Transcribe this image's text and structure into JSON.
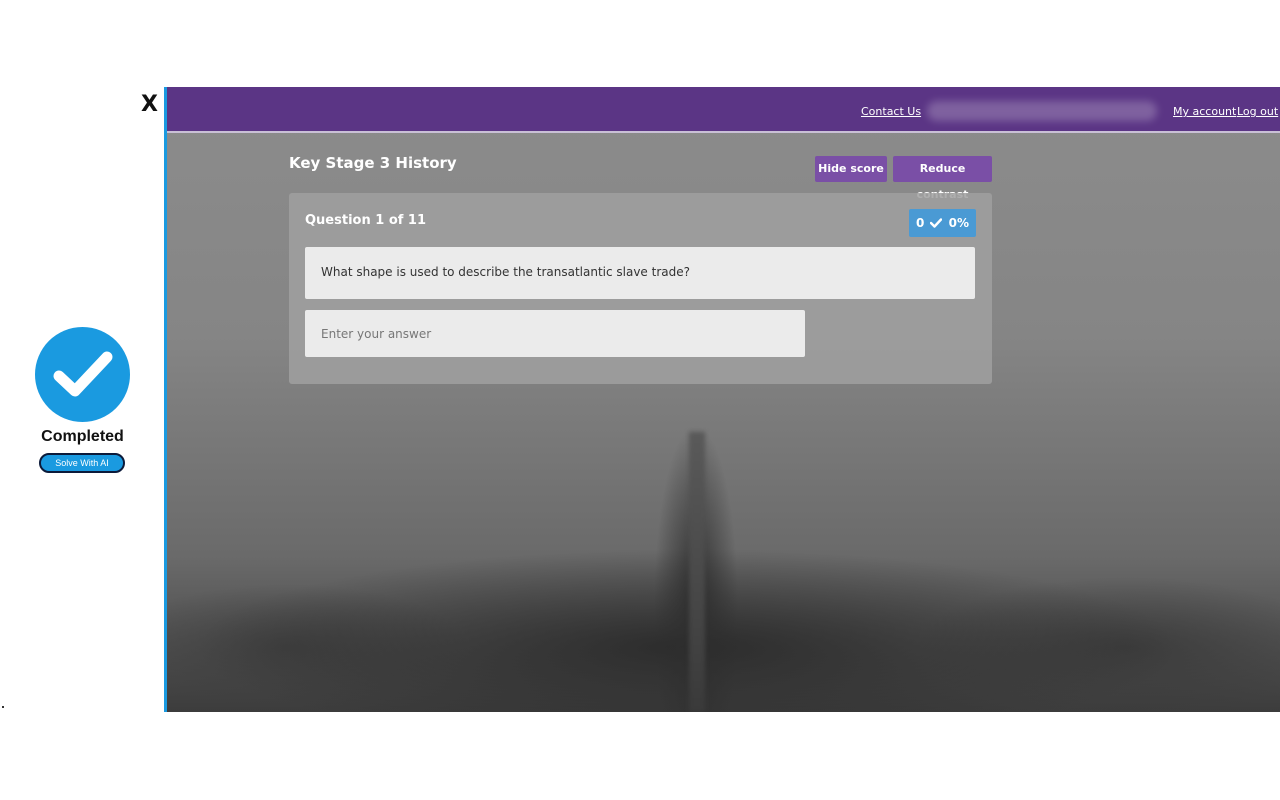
{
  "overlay": {
    "close_label": "X",
    "status_label": "Completed",
    "solve_button_label": "Solve With AI",
    "accent_color": "#1a9ae0"
  },
  "topbar": {
    "contact_label": "Contact Us",
    "my_account_label": "My account",
    "logout_label": "Log out",
    "background_color": "#5b3585"
  },
  "page": {
    "title": "Key Stage 3 History",
    "hide_score_label": "Hide score",
    "reduce_contrast_label": "Reduce contrast"
  },
  "quiz": {
    "question_counter": "Question 1 of 11",
    "score_correct": "0",
    "score_percent": "0%",
    "question_text": "What shape is used to describe the transatlantic slave trade?",
    "answer_value": "",
    "answer_placeholder": "Enter your answer"
  },
  "icons": {
    "status": "checkmark-circle-icon",
    "score": "checkmark-icon"
  }
}
